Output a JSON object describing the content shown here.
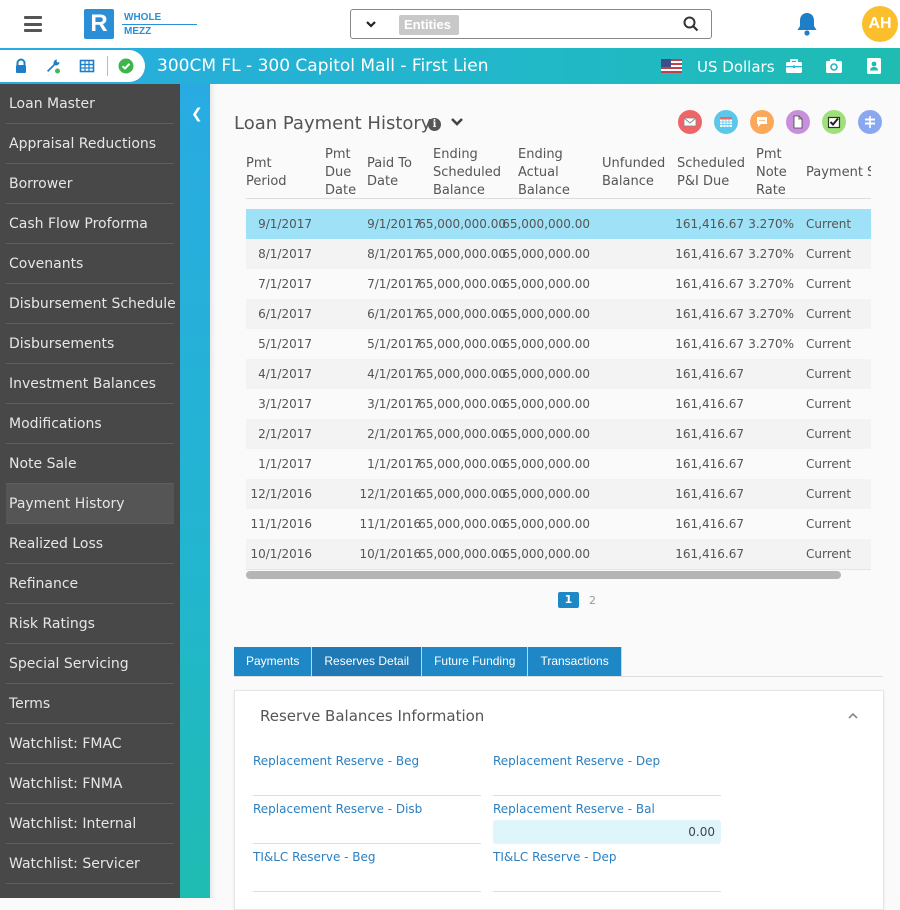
{
  "header": {
    "logo": {
      "mark": "R",
      "line1": "WHOLE",
      "line2": "MEZZ"
    },
    "search": {
      "dropdown_icon": "chevron-down-icon",
      "chip": "Entities",
      "value": "",
      "placeholder": ""
    },
    "avatar_initials": "AH",
    "colors": {
      "brand": "#2a8fd6",
      "avatar": "#fbbf2e",
      "bell": "#1e7fc8"
    }
  },
  "bluebar": {
    "title": "300CM FL - 300 Capitol Mall - First Lien",
    "currency": "US Dollars",
    "tool_icons": [
      "lock-icon",
      "wrench-icon",
      "grid-icon",
      "check-circle-icon"
    ],
    "right_icons": [
      "briefcase-icon",
      "camera-icon",
      "contact-book-icon"
    ]
  },
  "sidebar": {
    "items": [
      {
        "label": "Loan Master"
      },
      {
        "label": "Appraisal Reductions"
      },
      {
        "label": "Borrower"
      },
      {
        "label": "Cash Flow Proforma"
      },
      {
        "label": "Covenants"
      },
      {
        "label": "Disbursement Schedule"
      },
      {
        "label": "Disbursements"
      },
      {
        "label": "Investment Balances"
      },
      {
        "label": "Modifications"
      },
      {
        "label": "Note Sale"
      },
      {
        "label": "Payment History",
        "active": true
      },
      {
        "label": "Realized Loss"
      },
      {
        "label": "Refinance"
      },
      {
        "label": "Risk Ratings"
      },
      {
        "label": "Special Servicing"
      },
      {
        "label": "Terms"
      },
      {
        "label": "Watchlist: FMAC"
      },
      {
        "label": "Watchlist: FNMA"
      },
      {
        "label": "Watchlist: Internal"
      },
      {
        "label": "Watchlist: Servicer"
      }
    ]
  },
  "main": {
    "title": "Loan Payment History",
    "info_icon": "i",
    "action_icons": [
      {
        "name": "email-icon",
        "color": "#ef6466"
      },
      {
        "name": "calendar-icon",
        "color": "#5bc8ea"
      },
      {
        "name": "comment-icon",
        "color": "#fba85a"
      },
      {
        "name": "document-icon",
        "color": "#c88fdc"
      },
      {
        "name": "checkbox-icon",
        "color": "#9ee07a"
      },
      {
        "name": "signpost-icon",
        "color": "#8aa8f0"
      }
    ],
    "table": {
      "columns": [
        "Pmt Period",
        "Pmt Due Date",
        "Paid To Date",
        "Ending Scheduled Balance",
        "Ending Actual Balance",
        "Unfunded Balance",
        "Scheduled P&I Due",
        "Pmt Note Rate",
        "Payment S"
      ],
      "rows": [
        [
          "9/1/2017",
          "",
          "9/1/2017",
          "65,000,000.00",
          "65,000,000.00",
          "",
          "161,416.67",
          "3.270%",
          "Current"
        ],
        [
          "8/1/2017",
          "",
          "8/1/2017",
          "65,000,000.00",
          "65,000,000.00",
          "",
          "161,416.67",
          "3.270%",
          "Current"
        ],
        [
          "7/1/2017",
          "",
          "7/1/2017",
          "65,000,000.00",
          "65,000,000.00",
          "",
          "161,416.67",
          "3.270%",
          "Current"
        ],
        [
          "6/1/2017",
          "",
          "6/1/2017",
          "65,000,000.00",
          "65,000,000.00",
          "",
          "161,416.67",
          "3.270%",
          "Current"
        ],
        [
          "5/1/2017",
          "",
          "5/1/2017",
          "65,000,000.00",
          "65,000,000.00",
          "",
          "161,416.67",
          "3.270%",
          "Current"
        ],
        [
          "4/1/2017",
          "",
          "4/1/2017",
          "65,000,000.00",
          "65,000,000.00",
          "",
          "161,416.67",
          "",
          "Current"
        ],
        [
          "3/1/2017",
          "",
          "3/1/2017",
          "65,000,000.00",
          "65,000,000.00",
          "",
          "161,416.67",
          "",
          "Current"
        ],
        [
          "2/1/2017",
          "",
          "2/1/2017",
          "65,000,000.00",
          "65,000,000.00",
          "",
          "161,416.67",
          "",
          "Current"
        ],
        [
          "1/1/2017",
          "",
          "1/1/2017",
          "65,000,000.00",
          "65,000,000.00",
          "",
          "161,416.67",
          "",
          "Current"
        ],
        [
          "12/1/2016",
          "",
          "12/1/2016",
          "65,000,000.00",
          "65,000,000.00",
          "",
          "161,416.67",
          "",
          "Current"
        ],
        [
          "11/1/2016",
          "",
          "11/1/2016",
          "65,000,000.00",
          "65,000,000.00",
          "",
          "161,416.67",
          "",
          "Current"
        ],
        [
          "10/1/2016",
          "",
          "10/1/2016",
          "65,000,000.00",
          "65,000,000.00",
          "",
          "161,416.67",
          "",
          "Current"
        ]
      ],
      "selected_row": 0
    },
    "pagination": {
      "pages": [
        "1",
        "2"
      ],
      "current": "1"
    },
    "tabs": [
      {
        "label": "Payments"
      },
      {
        "label": "Reserves Detail",
        "active": true
      },
      {
        "label": "Future Funding"
      },
      {
        "label": "Transactions"
      }
    ],
    "panel": {
      "title": "Reserve Balances Information",
      "fields": [
        {
          "label": "Replacement Reserve - Beg",
          "value": ""
        },
        {
          "label": "Replacement Reserve - Dep",
          "value": ""
        },
        {
          "label": "Replacement Reserve - Disb",
          "value": ""
        },
        {
          "label": "Replacement Reserve - Bal",
          "value": "0.00"
        },
        {
          "label": "TI&LC Reserve - Beg",
          "value": ""
        },
        {
          "label": "TI&LC Reserve - Dep",
          "value": ""
        }
      ]
    }
  }
}
